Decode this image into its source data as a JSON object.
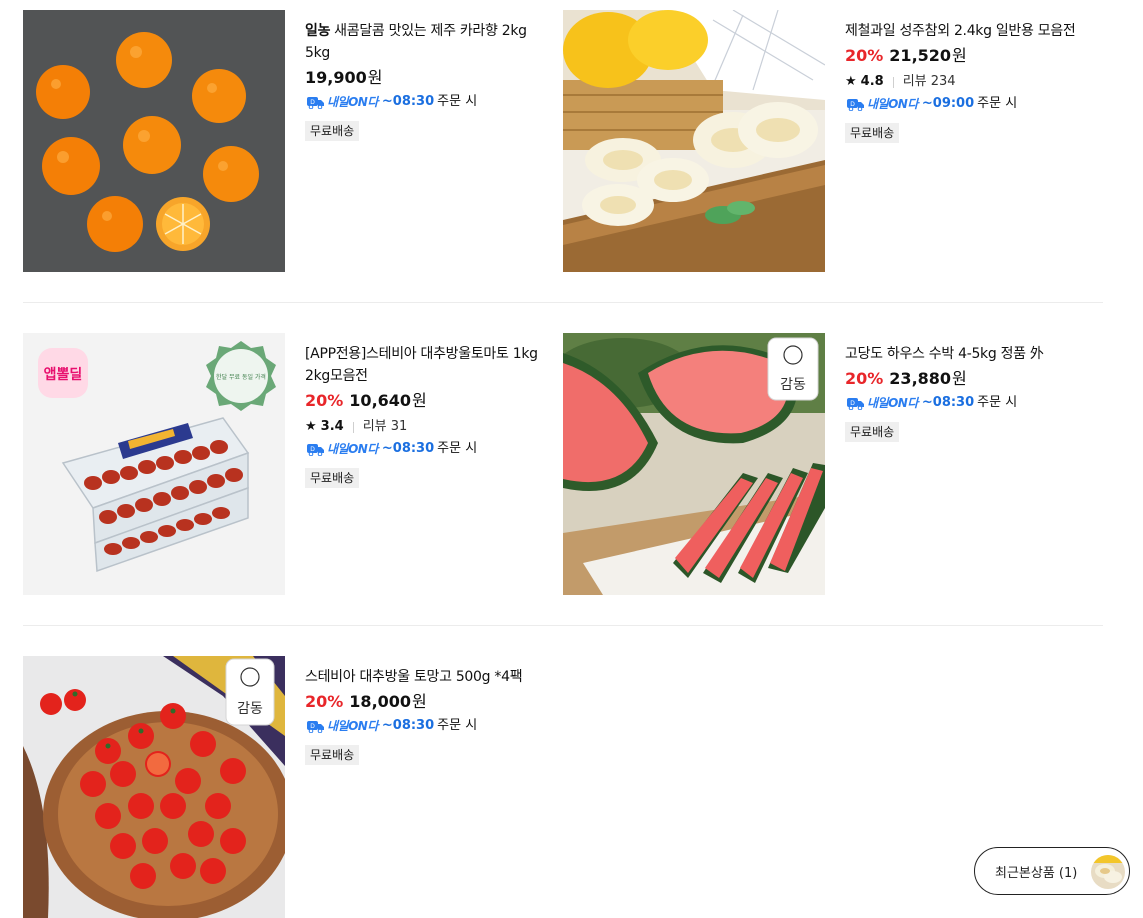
{
  "products": [
    {
      "brand": "일농",
      "title": "새콤달콤 맛있는 제주 카라향 2kg 5kg",
      "discount": "",
      "price": "19,900",
      "currency": "원",
      "rating": "",
      "reviews": "",
      "delivery_label": "내일ON다",
      "delivery_time": "~08:30",
      "delivery_suffix": "주문 시",
      "badge": "무료배송",
      "image_icon": "tangerines-photo"
    },
    {
      "brand": "",
      "title": "제철과일 성주참외 2.4kg 일반용 모음전",
      "discount": "20%",
      "price": "21,520",
      "currency": "원",
      "rating": "4.8",
      "reviews": "리뷰 234",
      "delivery_label": "내일ON다",
      "delivery_time": "~09:00",
      "delivery_suffix": "주문 시",
      "badge": "무료배송",
      "image_icon": "korean-melon-photo"
    },
    {
      "brand": "",
      "title": "[APP전용]스테비아 대추방울토마토 1kg 2kg모음전",
      "discount": "20%",
      "price": "10,640",
      "currency": "원",
      "rating": "3.4",
      "reviews": "리뷰 31",
      "delivery_label": "내일ON다",
      "delivery_time": "~08:30",
      "delivery_suffix": "주문 시",
      "badge": "무료배송",
      "image_icon": "cherry-tomato-pack-photo",
      "image_badge": "앱뽈딜",
      "image_stamp": "한달 무료 동일 가격"
    },
    {
      "brand": "",
      "title": "고당도 하우스 수박 4-5kg 정품 外",
      "discount": "20%",
      "price": "23,880",
      "currency": "원",
      "rating": "",
      "reviews": "",
      "delivery_label": "내일ON다",
      "delivery_time": "~08:30",
      "delivery_suffix": "주문 시",
      "badge": "무료배송",
      "image_icon": "watermelon-photo",
      "image_logo": "감동"
    },
    {
      "brand": "",
      "title": "스테비아 대추방울 토망고 500g *4팩",
      "discount": "20%",
      "price": "18,000",
      "currency": "원",
      "rating": "",
      "reviews": "",
      "delivery_label": "내일ON다",
      "delivery_time": "~08:30",
      "delivery_suffix": "주문 시",
      "badge": "무료배송",
      "image_icon": "tomato-bowl-photo",
      "image_logo": "감동"
    }
  ],
  "recent_viewed": {
    "label": "최근본상품 (1)",
    "icon": "recent-product-thumbnail"
  },
  "colors": {
    "discount": "#e8262a",
    "delivery": "#1b6fe0",
    "badge_bg": "#efefef",
    "separator": "#ececec"
  }
}
